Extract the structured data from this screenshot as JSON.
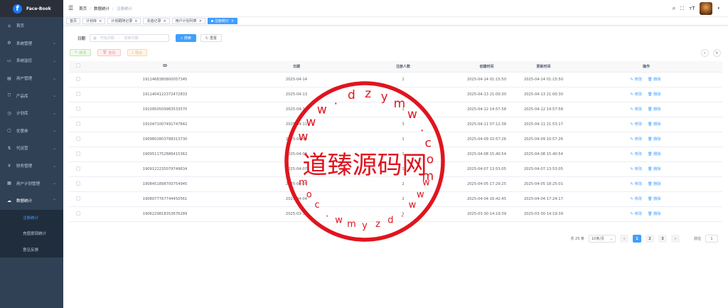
{
  "app": {
    "title": "Face-Book",
    "logo_letter": "f"
  },
  "sidebar": {
    "items": [
      {
        "label": "首页",
        "icon": "dashboard-icon",
        "glyph": "⌂",
        "chev": ""
      },
      {
        "label": "系统管理",
        "icon": "settings-icon",
        "glyph": "⚙",
        "chev": "⌄"
      },
      {
        "label": "系统监控",
        "icon": "monitor-icon",
        "glyph": "▭",
        "chev": "⌄"
      },
      {
        "label": "用户管理",
        "icon": "user-icon",
        "glyph": "▤",
        "chev": "⌄"
      },
      {
        "label": "产品库",
        "icon": "cart-icon",
        "glyph": "⛉",
        "chev": "⌄"
      },
      {
        "label": "计划库",
        "icon": "clock-icon",
        "glyph": "◷",
        "chev": "⌄"
      },
      {
        "label": "优惠券",
        "icon": "coupon-icon",
        "glyph": "▢",
        "chev": "⌄"
      },
      {
        "label": "代运营",
        "icon": "ops-icon",
        "glyph": "⇅",
        "chev": "⌄"
      },
      {
        "label": "财务管理",
        "icon": "yen-icon",
        "glyph": "¥",
        "chev": "⌄"
      },
      {
        "label": "用户计划管理",
        "icon": "plan-icon",
        "glyph": "▦",
        "chev": "⌄"
      },
      {
        "label": "数据统计",
        "icon": "stats-icon",
        "glyph": "☁",
        "chev": "⌃"
      }
    ],
    "sub_items": [
      {
        "label": "注册统计"
      },
      {
        "label": "充值提现统计"
      },
      {
        "label": "意见反馈"
      }
    ]
  },
  "breadcrumb": {
    "home": "首页",
    "parent": "数据统计",
    "current": "注册统计",
    "sep": "/"
  },
  "tags": [
    {
      "label": "首页"
    },
    {
      "label": "计划库"
    },
    {
      "label": "计划跟随记录"
    },
    {
      "label": "充值记录"
    },
    {
      "label": "用户计划列表"
    },
    {
      "label": "注册统计"
    }
  ],
  "search": {
    "date_label": "日期",
    "start_placeholder": "开始日期",
    "range_sep": "-",
    "end_placeholder": "结束日期",
    "search_btn": "搜索",
    "reset_btn": "重置"
  },
  "toolbar": {
    "edit": "修改",
    "delete": "删除",
    "export": "导出"
  },
  "table": {
    "headers": [
      "ID",
      "日期",
      "注册人数",
      "创建时间",
      "更新时间",
      "操作"
    ],
    "edit_label": "修改",
    "delete_label": "删除",
    "rows": [
      {
        "id": "1911468380800057345",
        "date": "2025-04-14",
        "count": "1",
        "created": "2025-04-14 01:15:50",
        "updated": "2025-04-14 01:15:50"
      },
      {
        "id": "1911404122372472833",
        "date": "2025-04-13",
        "count": "1",
        "created": "2025-04-13 21:00:30",
        "updated": "2025-04-13 21:00:30"
      },
      {
        "id": "1910950509983533570",
        "date": "2025-04-12",
        "count": "1",
        "created": "2025-04-12 14:57:58",
        "updated": "2025-04-12 14:57:58"
      },
      {
        "id": "1910471007491747842",
        "date": "2025-04-11",
        "count": "3",
        "created": "2025-04-11 07:12:38",
        "updated": "2025-04-11 21:53:17"
      },
      {
        "id": "1909802803788313730",
        "date": "2025-04-09",
        "count": "1",
        "created": "2025-04-09 10:57:26",
        "updated": "2025-04-09 10:57:26"
      },
      {
        "id": "1909511752886415362",
        "date": "2025-04-08",
        "count": "1",
        "created": "2025-04-08 15:40:54",
        "updated": "2025-04-08 15:40:54"
      },
      {
        "id": "1909122235079749634",
        "date": "2025-04-07",
        "count": "1",
        "created": "2025-04-07 13:53:05",
        "updated": "2025-04-07 13:53:05"
      },
      {
        "id": "1908451898700754945",
        "date": "2025-04-05",
        "count": "2",
        "created": "2025-04-05 17:29:25",
        "updated": "2025-04-05 18:25:01"
      },
      {
        "id": "1908077767744450561",
        "date": "2025-04-04",
        "count": "2",
        "created": "2025-04-04 16:42:45",
        "updated": "2025-04-04 17:24:17"
      },
      {
        "id": "1906229818353676289",
        "date": "2025-03-30",
        "count": "1",
        "created": "2025-03-30 14:19:39",
        "updated": "2025-03-30 14:19:39"
      }
    ]
  },
  "pagination": {
    "total": "共 25 条",
    "page_size": "10条/页",
    "prev": "‹",
    "next": "›",
    "pages": [
      "1",
      "2",
      "3"
    ],
    "current": "1",
    "goto_label": "前往",
    "goto_value": "1"
  },
  "watermark": {
    "text": "道臻源码网",
    "ring_text": "www.dzymw.com",
    "color": "#e0141e"
  }
}
